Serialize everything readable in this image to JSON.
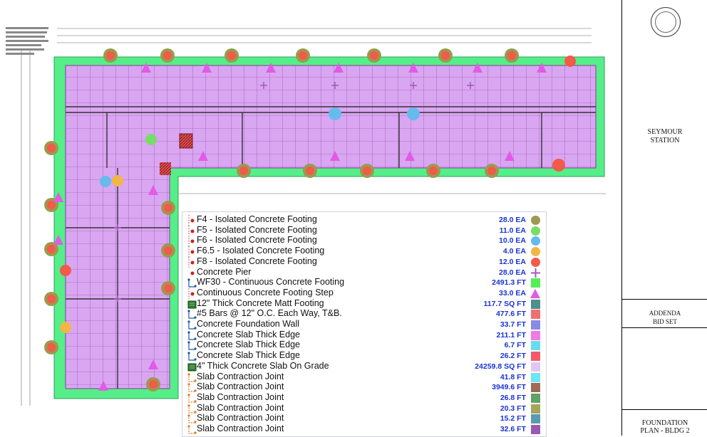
{
  "title_block": {
    "project_name_1": "SEYMOUR",
    "project_name_2": "STATION",
    "bid_set_1": "ADDENDA",
    "bid_set_2": "BID SET",
    "sheet_title_1": "FOUNDATION",
    "sheet_title_2": "PLAN - BLDG 2"
  },
  "colors": {
    "slab_fill": "#d9a6f2",
    "footing_fill": "#55ee88",
    "grid_line": "#8a3a9e",
    "qty_text": "#1833d6"
  },
  "legend": [
    {
      "label": "F4 - Isolated Concrete Footing",
      "qty": "28.0 EA",
      "color": "#9c9a4e",
      "shape": "circle",
      "marker": "dot-line"
    },
    {
      "label": "F5 - Isolated Concrete Footing",
      "qty": "11.0 EA",
      "color": "#77dd66",
      "shape": "circle",
      "marker": "dot-line"
    },
    {
      "label": "F6 - Isolated Concrete Footing",
      "qty": "10.0 EA",
      "color": "#66bbee",
      "shape": "circle",
      "marker": "dot-line"
    },
    {
      "label": "F6.5 - Isolated Concrete Footing",
      "qty": "4.0 EA",
      "color": "#f3b545",
      "shape": "circle",
      "marker": "dot-line"
    },
    {
      "label": "F8 - Isolated Concrete Footing",
      "qty": "12.0 EA",
      "color": "#f25a4a",
      "shape": "circle",
      "marker": "dot-line"
    },
    {
      "label": "Concrete Pier",
      "qty": "28.0 EA",
      "color": "#a05ab5",
      "shape": "plus",
      "marker": "dot"
    },
    {
      "label": "WF30 - Continuous Concrete Footing",
      "qty": "2491.3 FT",
      "color": "#55ee55",
      "shape": "square",
      "marker": "linear"
    },
    {
      "label": "Continuous Concrete Footing Step",
      "qty": "33.0 EA",
      "color": "#e25ae6",
      "shape": "triangle",
      "marker": "dot-line"
    },
    {
      "label": "12\" Thick Concrete Matt Footing",
      "qty": "117.7 SQ FT",
      "color": "#4f8f8f",
      "shape": "square",
      "marker": "area"
    },
    {
      "label": "#5 Bars @ 12\" O.C. Each Way, T&B.",
      "qty": "477.6 FT",
      "color": "#f07070",
      "shape": "square",
      "marker": "linear"
    },
    {
      "label": "Concrete Foundation Wall",
      "qty": "33.7 FT",
      "color": "#8a8ae8",
      "shape": "square",
      "marker": "linear"
    },
    {
      "label": "Concrete Slab Thick Edge",
      "qty": "211.1 FT",
      "color": "#f27ae6",
      "shape": "square",
      "marker": "linear"
    },
    {
      "label": "Concrete Slab Thick Edge",
      "qty": "6.7 FT",
      "color": "#66ddee",
      "shape": "square",
      "marker": "linear"
    },
    {
      "label": "Concrete Slab Thick Edge",
      "qty": "26.2 FT",
      "color": "#f25a6a",
      "shape": "square",
      "marker": "linear"
    },
    {
      "label": "4\" Thick Concrete Slab On Grade",
      "qty": "24259.8 SQ FT",
      "color": "#e2c6f2",
      "shape": "square",
      "marker": "area"
    },
    {
      "label": "Slab Contraction Joint",
      "qty": "41.8 FT",
      "color": "#6ae6f6",
      "shape": "square",
      "marker": "joint"
    },
    {
      "label": "Slab Contraction Joint",
      "qty": "3949.6 FT",
      "color": "#a06a55",
      "shape": "square",
      "marker": "joint"
    },
    {
      "label": "Slab Contraction Joint",
      "qty": "26.8 FT",
      "color": "#5fa26a",
      "shape": "square",
      "marker": "joint"
    },
    {
      "label": "Slab Contraction Joint",
      "qty": "20.3 FT",
      "color": "#a6a65a",
      "shape": "square",
      "marker": "joint"
    },
    {
      "label": "Slab Contraction Joint",
      "qty": "15.2 FT",
      "color": "#5a9ab2",
      "shape": "square",
      "marker": "joint"
    },
    {
      "label": "Slab Contraction Joint",
      "qty": "32.6 FT",
      "color": "#9a5ab2",
      "shape": "square",
      "marker": "joint"
    }
  ]
}
